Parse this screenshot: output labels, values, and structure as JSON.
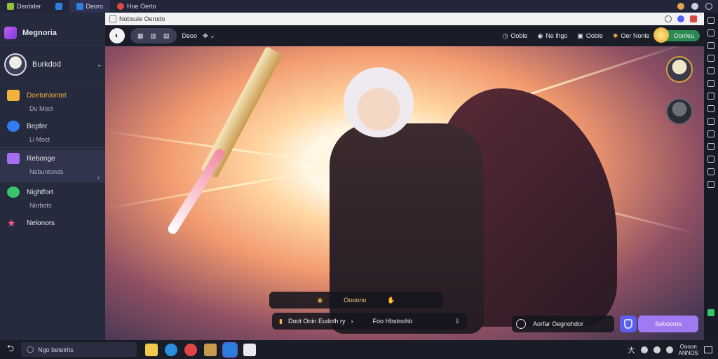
{
  "window_tabs": [
    {
      "label": "Deobder",
      "color": "#8fc13a"
    },
    {
      "label": "",
      "color": "#2a7fe0"
    },
    {
      "label": "Deoro",
      "color": "#2a7fe0"
    },
    {
      "label": "Hoe Oerto",
      "color": "#e24545"
    }
  ],
  "browser": {
    "url": "Nobsuie Oerodo"
  },
  "sidebar": {
    "app_name": "Megnoria",
    "user_name": "Burkdod",
    "items": [
      {
        "label": "Doetohlontet",
        "sub": "Du Moct",
        "color": "#f2b33d"
      },
      {
        "label": "Bepfer",
        "sub": "Li Moct",
        "color": "#2f7df0"
      },
      {
        "label": "Rebonge",
        "sub": "Nebuntonds",
        "color": "#a66ff0"
      },
      {
        "label": "Nightfort",
        "sub": "Norbots",
        "color": "#3ac46c"
      },
      {
        "label": "Nelonors",
        "sub": "",
        "color": "#f05a7e"
      }
    ]
  },
  "toolbar": {
    "view_label": "Deoo",
    "right": [
      "Ooble",
      "Ne lhgo",
      "Ooble",
      "Oer Nonle",
      "Oonfeu"
    ]
  },
  "scene": {
    "bottom_bar_1": "Oooono",
    "bottom_bar_2_left": "Doot Ooin Eudoth ry",
    "bottom_bar_2_right": "Foo Hbstnohb",
    "status_text": "Aorfar Oegnohdor",
    "action_button": "Sehooms"
  },
  "taskbar": {
    "search_text": "Ngo beteirits",
    "clock_time": "Oooon",
    "clock_date": "ANNOS"
  }
}
